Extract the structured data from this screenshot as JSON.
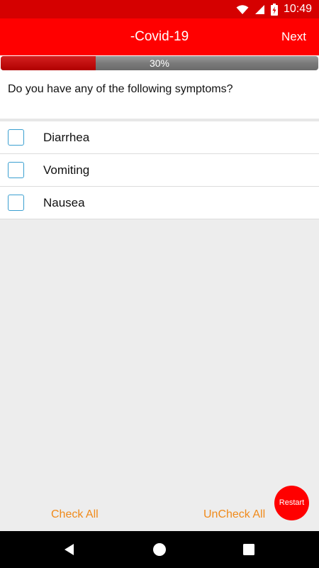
{
  "status_bar": {
    "time": "10:49",
    "icons": [
      "wifi-icon",
      "signal-icon",
      "battery-charging-icon"
    ]
  },
  "app_bar": {
    "title": "-Covid-19",
    "next_label": "Next"
  },
  "progress": {
    "text": "30%",
    "value": 0.3
  },
  "question": {
    "text": "Do you have any of the following symptoms?"
  },
  "options": [
    {
      "label": "Diarrhea",
      "checked": false
    },
    {
      "label": "Vomiting",
      "checked": false
    },
    {
      "label": "Nausea",
      "checked": false
    }
  ],
  "actions": {
    "check_all": "Check All",
    "uncheck_all": "UnCheck All",
    "restart": "Restart"
  },
  "nav_bar": {
    "icons": [
      "back-icon",
      "home-icon",
      "recents-icon"
    ]
  },
  "colors": {
    "app_bar": "#ff0000",
    "status_bar": "#d50000",
    "action_text": "#f08a1a",
    "checkbox_border": "#3a9fd0"
  }
}
